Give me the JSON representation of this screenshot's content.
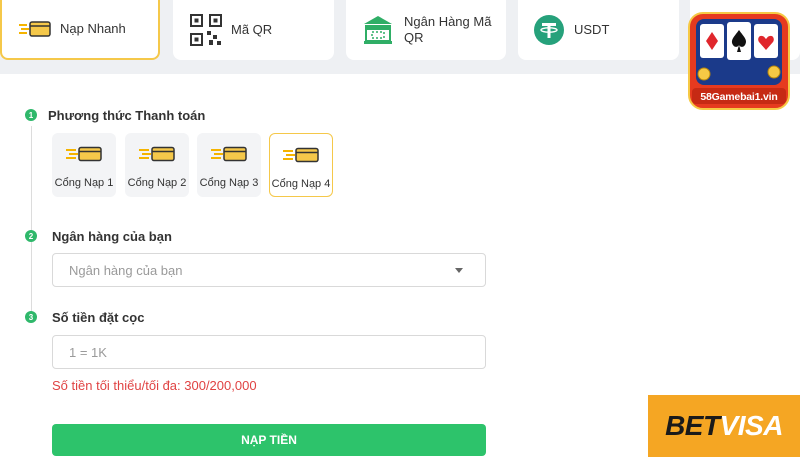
{
  "tabs": [
    {
      "label": "Nạp Nhanh",
      "icon": "card-fast-icon",
      "active": true
    },
    {
      "label": "Mã QR",
      "icon": "qr-code-icon",
      "active": false
    },
    {
      "label": "Ngân Hàng Mã QR",
      "icon": "bank-icon",
      "active": false
    },
    {
      "label": "USDT",
      "icon": "tether-icon",
      "active": false
    }
  ],
  "form": {
    "step1": {
      "num": "1",
      "title": "Phương thức Thanh toán"
    },
    "gates": [
      {
        "label": "Cổng Nạp 1",
        "active": false
      },
      {
        "label": "Cổng Nạp 2",
        "active": false
      },
      {
        "label": "Cổng Nạp 3",
        "active": false
      },
      {
        "label": "Cổng Nạp 4",
        "active": true
      }
    ],
    "step2": {
      "num": "2",
      "title": "Ngân hàng của bạn",
      "placeholder": "Ngân hàng của bạn"
    },
    "step3": {
      "num": "3",
      "title": "Số tiền đặt cọc",
      "placeholder": "1 = 1K"
    },
    "hint": "Số tiền tối thiểu/tối đa: 300/200,000",
    "submit_label": "NẠP TIỀN"
  },
  "logos": {
    "site_name": "58Gamebai1.vin",
    "betvisa_part1": "BET",
    "betvisa_part2": "VISA"
  },
  "colors": {
    "accent_green": "#2dc36b",
    "active_border": "#f5c84a",
    "hint_red": "#e04343",
    "betvisa_orange": "#f5a623"
  }
}
